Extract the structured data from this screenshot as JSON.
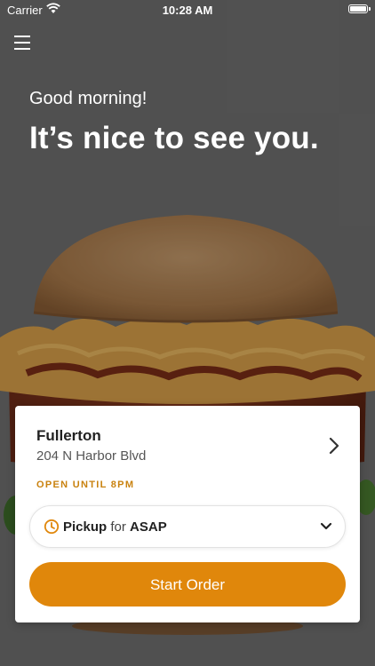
{
  "status_bar": {
    "carrier": "Carrier",
    "time": "10:28 AM"
  },
  "header": {
    "menu_icon": "hamburger-menu-icon"
  },
  "greeting": {
    "line1": "Good morning!",
    "line2": "It’s nice to see you."
  },
  "store": {
    "name": "Fullerton",
    "address": "204 N Harbor Blvd",
    "status": "OPEN UNTIL 8PM",
    "chevron_icon": "chevron-right-icon"
  },
  "order_method": {
    "mode": "Pickup",
    "connector": "for",
    "time": "ASAP",
    "icon": "clock-icon",
    "dropdown_icon": "chevron-down-icon"
  },
  "cta": {
    "label": "Start Order"
  },
  "colors": {
    "accent": "#e0870b",
    "status_text": "#c9820f",
    "background_overlay": "#6e6e6e"
  }
}
